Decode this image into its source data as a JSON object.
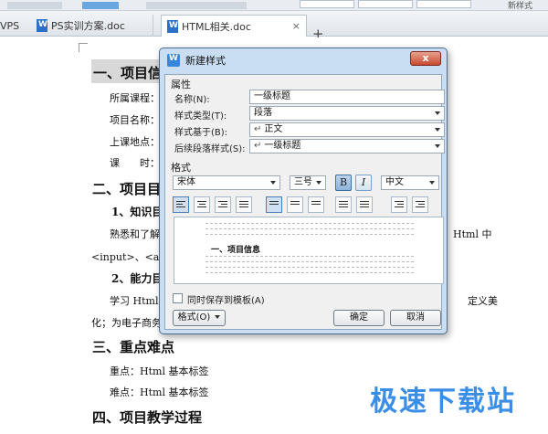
{
  "toolbar": {
    "right_text": "新样式"
  },
  "tabs": {
    "wps_label": "VPS",
    "doc1": "PS实训方案.doc",
    "doc2": "HTML相关.doc",
    "close": "×",
    "new": "+"
  },
  "document": {
    "h1_1": "一、项目信",
    "course": "所属课程：",
    "project_name": "项目名称：",
    "location": "上课地点：",
    "time": "课　　时：",
    "h1_2": "二、项目目",
    "h2_1": "1、知识目标",
    "para1_start": "熟悉和了解",
    "para1_end": "Html 中",
    "para2": "<input>、<a>等",
    "h2_2": "2、能力目标",
    "para3_start": "学习 Html 的",
    "para3_end": "定义美",
    "para4": "化；为电子商务",
    "h1_3": "三、重点难点",
    "key_point": "重点：Html 基本标签",
    "difficulty": "难点：Html 基本标签",
    "h1_4": "四、项目教学过程"
  },
  "watermark": "极速下载站",
  "dialog": {
    "title": "新建样式",
    "close": "x",
    "properties_section": "属性",
    "name_label": "名称(N):",
    "name_value": "一级标题",
    "type_label": "样式类型(T):",
    "type_value": "段落",
    "based_label": "样式基于(B):",
    "based_value": "正文",
    "next_label": "后续段落样式(S):",
    "next_value": "一级标题",
    "format_section": "格式",
    "font": "宋体",
    "size": "三号",
    "bold": "B",
    "italic": "I",
    "language": "中文",
    "preview_heading": "一、项目信息",
    "checkbox_label": "同时保存到模板(A)",
    "format_button": "格式(O)",
    "ok_button": "确定",
    "cancel_button": "取消"
  }
}
